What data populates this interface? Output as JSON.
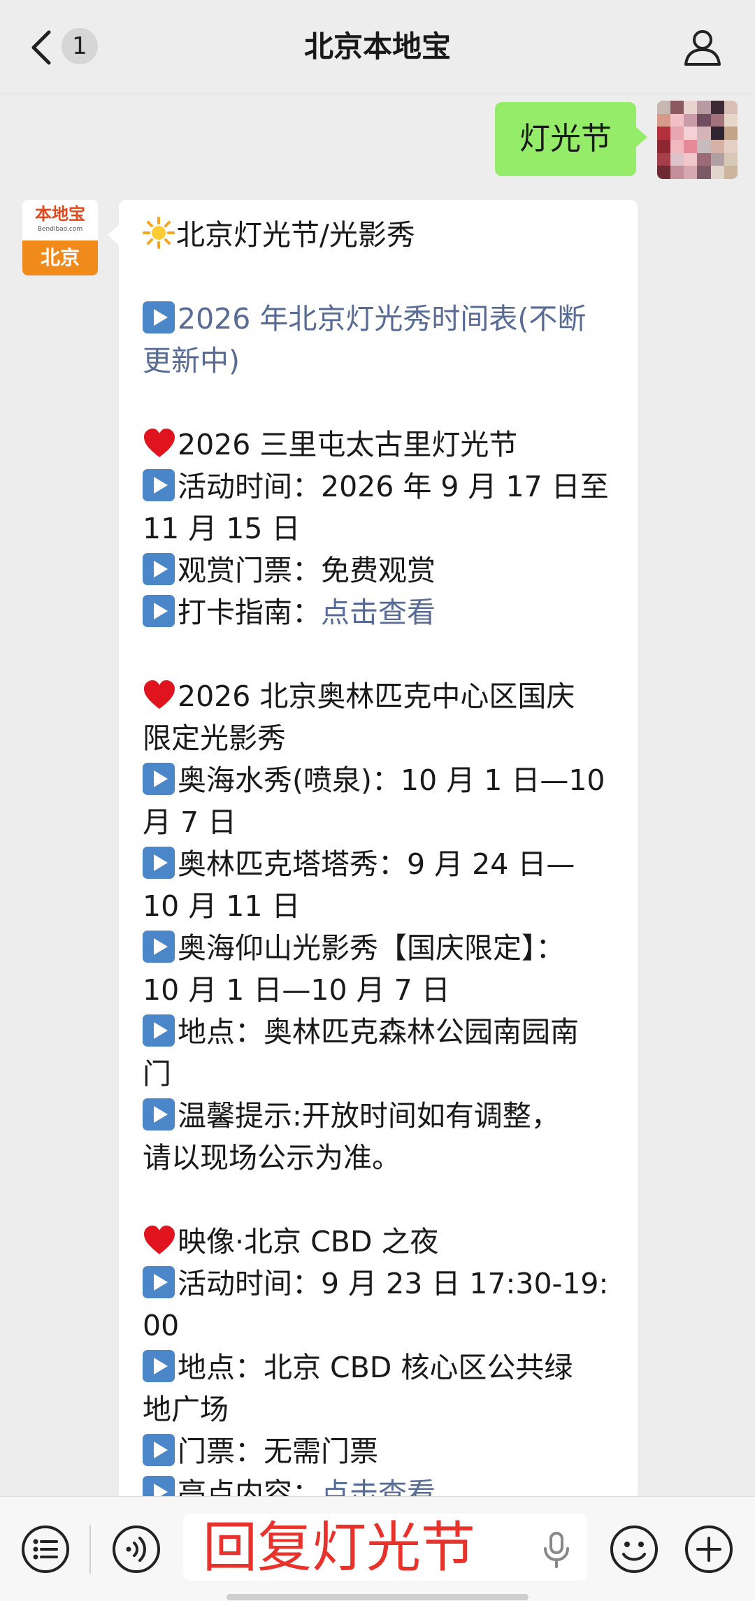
{
  "header": {
    "title": "北京本地宝",
    "unread_count": "1"
  },
  "chat": {
    "user_message": "灯光节",
    "bot_avatar": {
      "logo_text": "本地宝",
      "domain_text": "Bendibao.com",
      "city": "北京"
    },
    "reply": {
      "l01": "北京灯光节/光影秀",
      "l02": "2026 年北京灯光秀时间表(不断",
      "l03": "更新中)",
      "l04": "2026 三里屯太古里灯光节",
      "l05": "活动时间：2026 年 9 月 17 日至",
      "l06": "11 月 15 日",
      "l07": "观赏门票：免费观赏",
      "l08a": "打卡指南：",
      "l08b": "点击查看",
      "l09": "2026 北京奥林匹克中心区国庆",
      "l10": "限定光影秀",
      "l11": "奥海水秀(喷泉)：10 月 1 日—10",
      "l12": "月 7 日",
      "l13": "奥林匹克塔塔秀：9 月 24 日—",
      "l14": "10 月 11 日",
      "l15": "奥海仰山光影秀【国庆限定】：",
      "l16": "10 月 1 日—10 月 7 日",
      "l17": "地点：奥林匹克森林公园南园南",
      "l18": "门",
      "l19": "温馨提示:开放时间如有调整，",
      "l20": "请以现场公示为准。",
      "l21": "映像·北京 CBD 之夜",
      "l22": "活动时间：9 月 23 日 17:30-19:",
      "l23": "00",
      "l24": "地点：北京 CBD 核心区公共绿",
      "l25": "地广场",
      "l26": "门票：无需门票",
      "l27a": "亮点内容：",
      "l27b": "点击查看"
    }
  },
  "input_bar": {
    "text": "回复灯光节"
  },
  "colors": {
    "my_bubble": "#95ec69",
    "link": "#576b95",
    "input_text": "#e8332c",
    "background": "#ededed"
  }
}
